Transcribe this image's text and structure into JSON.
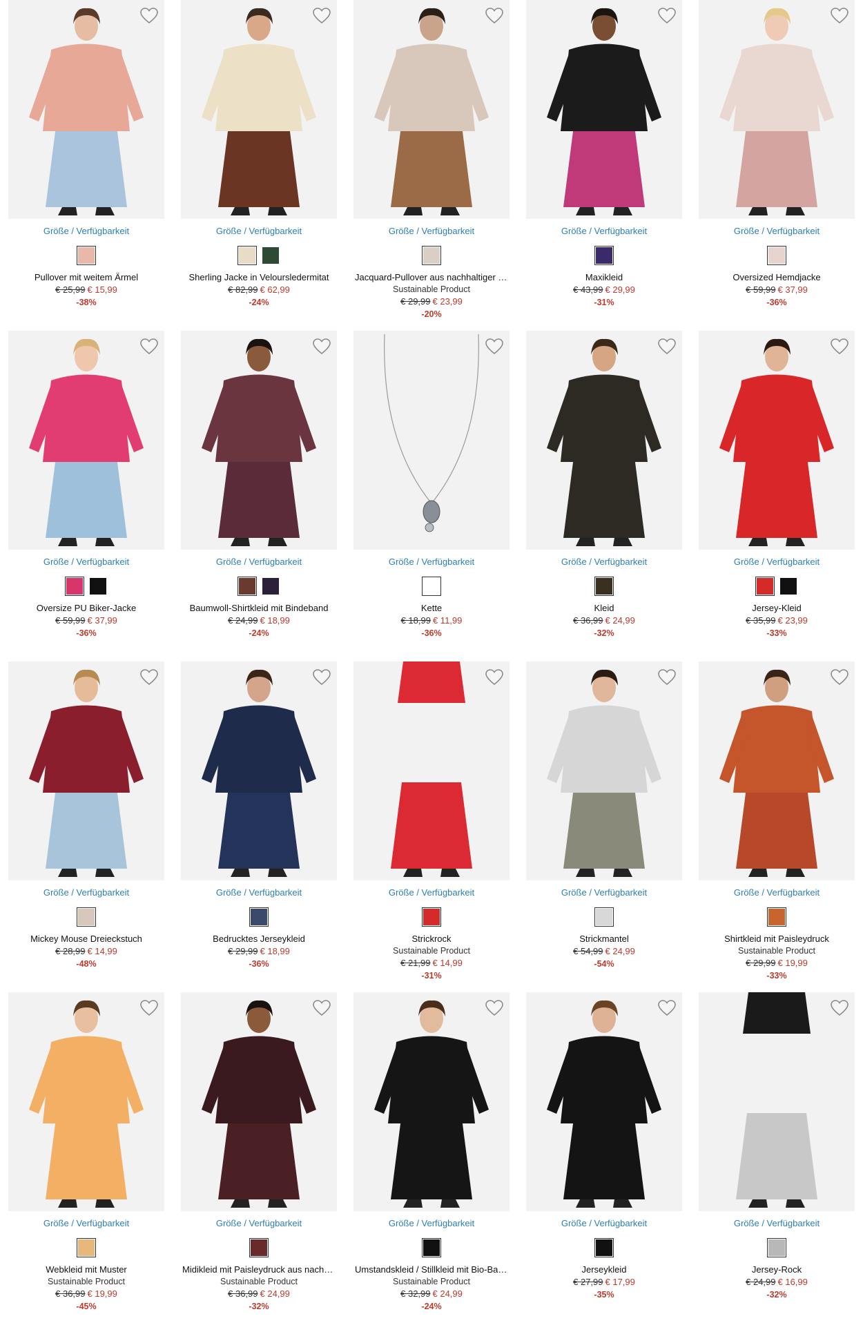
{
  "size_link_label": "Größe / Verfügbarkeit",
  "colors": {
    "link": "#2b7fb8",
    "sale": "#c0392b",
    "image_bg": "#f2f2f2"
  },
  "products": [
    {
      "name": "Pullover mit weitem Ärmel",
      "sustainable": "",
      "old_price": "€ 25,99",
      "new_price": "€ 15,99",
      "discount": "-38%",
      "swatches": [
        "#e9b8aa"
      ],
      "colors": {
        "top": "#e7a898",
        "bottom": "#a9c4dc",
        "skin": "#e6bda2",
        "hair": "#5a3a28"
      }
    },
    {
      "name": "Sherling Jacke in Veloursledermitat",
      "sustainable": "",
      "old_price": "€ 82,99",
      "new_price": "€ 62,99",
      "discount": "-24%",
      "swatches": [
        "#e9dcc6",
        "#2e4a34"
      ],
      "colors": {
        "top": "#ece0c6",
        "bottom": "#6a3522",
        "skin": "#d9a888",
        "hair": "#3a2a20"
      }
    },
    {
      "name": "Jacquard-Pullover aus nachhaltiger Viskose",
      "sustainable": "Sustainable Product",
      "old_price": "€ 29,99",
      "new_price": "€ 23,99",
      "discount": "-20%",
      "swatches": [
        "#d9cfc4"
      ],
      "colors": {
        "top": "#d8c8bb",
        "bottom": "#9b6b48",
        "skin": "#caa48a",
        "hair": "#2b2018"
      }
    },
    {
      "name": "Maxikleid",
      "sustainable": "",
      "old_price": "€ 43,99",
      "new_price": "€ 29,99",
      "discount": "-31%",
      "swatches": [
        "#3b2a6a"
      ],
      "colors": {
        "top": "#1b1b1b",
        "bottom": "#c03a7a",
        "skin": "#7a4e32",
        "hair": "#1b1410"
      }
    },
    {
      "name": "Oversized Hemdjacke",
      "sustainable": "",
      "old_price": "€ 59,99",
      "new_price": "€ 37,99",
      "discount": "-36%",
      "swatches": [
        "#e8d4cf"
      ],
      "colors": {
        "top": "#e9d7d2",
        "bottom": "#d3a4a0",
        "skin": "#efcbb6",
        "hair": "#e4c98a"
      }
    },
    {
      "name": "Oversize PU Biker-Jacke",
      "sustainable": "",
      "old_price": "€ 59,99",
      "new_price": "€ 37,99",
      "discount": "-36%",
      "swatches": [
        "#d8356a",
        "#111111"
      ],
      "colors": {
        "top": "#e23d72",
        "bottom": "#9fc0da",
        "skin": "#efc7ad",
        "hair": "#d9b27a"
      }
    },
    {
      "name": "Baumwoll-Shirtkleid mit Bindeband",
      "sustainable": "",
      "old_price": "€ 24,99",
      "new_price": "€ 18,99",
      "discount": "-24%",
      "swatches": [
        "#6a3a30",
        "#2b1f3a"
      ],
      "colors": {
        "top": "#6b3540",
        "bottom": "#5a2c3a",
        "skin": "#8a5a3c",
        "hair": "#1a1410"
      }
    },
    {
      "name": "Kette",
      "sustainable": "",
      "old_price": "€ 18,99",
      "new_price": "€ 11,99",
      "discount": "-36%",
      "swatches": [
        "#ffffff"
      ],
      "colors": {
        "top": "#f2f2f2",
        "bottom": "#f2f2f2",
        "skin": "#f2f2f2",
        "hair": "#f2f2f2"
      }
    },
    {
      "name": "Kleid",
      "sustainable": "",
      "old_price": "€ 36,99",
      "new_price": "€ 24,99",
      "discount": "-32%",
      "swatches": [
        "#3a3020"
      ],
      "colors": {
        "top": "#2c2a22",
        "bottom": "#2c2a22",
        "skin": "#d6a684",
        "hair": "#3a2818"
      }
    },
    {
      "name": "Jersey-Kleid",
      "sustainable": "",
      "old_price": "€ 35,99",
      "new_price": "€ 23,99",
      "discount": "-33%",
      "swatches": [
        "#d42a2a",
        "#111111"
      ],
      "colors": {
        "top": "#d92628",
        "bottom": "#d92628",
        "skin": "#e0b597",
        "hair": "#2a1a12"
      }
    },
    {
      "name": "Mickey Mouse Dreieckstuch",
      "sustainable": "",
      "old_price": "€ 28,99",
      "new_price": "€ 14,99",
      "discount": "-48%",
      "swatches": [
        "#d8c8bc"
      ],
      "colors": {
        "top": "#8a1e2c",
        "bottom": "#a8c4da",
        "skin": "#e6bb9a",
        "hair": "#b78a52"
      }
    },
    {
      "name": "Bedrucktes Jerseykleid",
      "sustainable": "",
      "old_price": "€ 29,99",
      "new_price": "€ 18,99",
      "discount": "-36%",
      "swatches": [
        "#3a4a6a"
      ],
      "colors": {
        "top": "#1f2b4a",
        "bottom": "#24335a",
        "skin": "#d4a58a",
        "hair": "#3a2618"
      }
    },
    {
      "name": "Strickrock",
      "sustainable": "Sustainable Product",
      "old_price": "€ 21,99",
      "new_price": "€ 14,99",
      "discount": "-31%",
      "swatches": [
        "#d42a2a"
      ],
      "colors": {
        "top": "#dc2a34",
        "bottom": "#dc2a34",
        "skin": "#f2f2f2",
        "hair": "#f2f2f2"
      }
    },
    {
      "name": "Strickmantel",
      "sustainable": "",
      "old_price": "€ 54,99",
      "new_price": "€ 24,99",
      "discount": "-54%",
      "swatches": [
        "#d8d8d8"
      ],
      "colors": {
        "top": "#d6d6d6",
        "bottom": "#8a8a7a",
        "skin": "#e0b79a",
        "hair": "#2a1c14"
      }
    },
    {
      "name": "Shirtkleid mit Paisleydruck",
      "sustainable": "Sustainable Product",
      "old_price": "€ 29,99",
      "new_price": "€ 19,99",
      "discount": "-33%",
      "swatches": [
        "#c8642e"
      ],
      "colors": {
        "top": "#c5552a",
        "bottom": "#b8482a",
        "skin": "#cf9f80",
        "hair": "#3a2418"
      }
    },
    {
      "name": "Webkleid mit Muster",
      "sustainable": "Sustainable Product",
      "old_price": "€ 36,99",
      "new_price": "€ 19,99",
      "discount": "-45%",
      "swatches": [
        "#e8b87a"
      ],
      "colors": {
        "top": "#f3b064",
        "bottom": "#f3b064",
        "skin": "#e8c0a0",
        "hair": "#5a3a20"
      }
    },
    {
      "name": "Midikleid mit Paisleydruck aus nachhaltiger Viskose",
      "sustainable": "Sustainable Product",
      "old_price": "€ 36,99",
      "new_price": "€ 24,99",
      "discount": "-32%",
      "swatches": [
        "#6a2a2a"
      ],
      "colors": {
        "top": "#3a1a1e",
        "bottom": "#4a2024",
        "skin": "#8a5a3a",
        "hair": "#1a1210"
      }
    },
    {
      "name": "Umstandskleid / Stillkleid mit Bio-Baumwolle",
      "sustainable": "Sustainable Product",
      "old_price": "€ 32,99",
      "new_price": "€ 24,99",
      "discount": "-24%",
      "swatches": [
        "#111111"
      ],
      "colors": {
        "top": "#151515",
        "bottom": "#151515",
        "skin": "#e2bb9c",
        "hair": "#4a2e1c"
      }
    },
    {
      "name": "Jerseykleid",
      "sustainable": "",
      "old_price": "€ 27,99",
      "new_price": "€ 17,99",
      "discount": "-35%",
      "swatches": [
        "#111111"
      ],
      "colors": {
        "top": "#141414",
        "bottom": "#141414",
        "skin": "#deb295",
        "hair": "#6a4424"
      }
    },
    {
      "name": "Jersey-Rock",
      "sustainable": "",
      "old_price": "€ 24,99",
      "new_price": "€ 16,99",
      "discount": "-32%",
      "swatches": [
        "#b8b8b8"
      ],
      "colors": {
        "top": "#1a1a1a",
        "bottom": "#c8c8c8",
        "skin": "#f2f2f2",
        "hair": "#f2f2f2"
      }
    }
  ]
}
